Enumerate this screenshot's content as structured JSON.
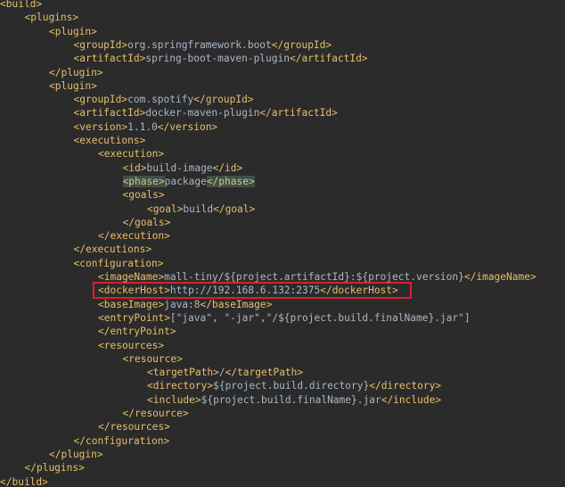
{
  "lines": [
    {
      "indent": 0,
      "open": "<build>"
    },
    {
      "indent": 1,
      "open": "<plugins>"
    },
    {
      "indent": 2,
      "open": "<plugin>"
    },
    {
      "indent": 3,
      "open": "<groupId>",
      "text": "org.springframework.boot",
      "close": "</groupId>"
    },
    {
      "indent": 3,
      "open": "<artifactId>",
      "text": "spring-boot-maven-plugin",
      "close": "</artifactId>"
    },
    {
      "indent": 2,
      "open": "</plugin>"
    },
    {
      "indent": 2,
      "open": "<plugin>"
    },
    {
      "indent": 3,
      "open": "<groupId>",
      "text": "com.spotify",
      "close": "</groupId>"
    },
    {
      "indent": 3,
      "open": "<artifactId>",
      "text": "docker-maven-plugin",
      "close": "</artifactId>"
    },
    {
      "indent": 3,
      "open": "<version>",
      "text": "1.1.0",
      "close": "</version>"
    },
    {
      "indent": 3,
      "open": "<executions>"
    },
    {
      "indent": 4,
      "open": "<execution>"
    },
    {
      "indent": 5,
      "open": "<id>",
      "text": "build-image",
      "close": "</id>"
    },
    {
      "indent": 5,
      "open": "<phase>",
      "text": "package",
      "close": "</phase>",
      "highlight": true
    },
    {
      "indent": 5,
      "open": "<goals>"
    },
    {
      "indent": 6,
      "open": "<goal>",
      "text": "build",
      "close": "</goal>"
    },
    {
      "indent": 5,
      "open": "</goals>"
    },
    {
      "indent": 4,
      "open": "</execution>"
    },
    {
      "indent": 3,
      "open": "</executions>"
    },
    {
      "indent": 3,
      "open": "<configuration>"
    },
    {
      "indent": 4,
      "open": "<imageName>",
      "text": "mall-tiny/${project.artifactId}:${project.version}",
      "close": "</imageName>"
    },
    {
      "indent": 4,
      "open": "<dockerHost>",
      "text": "http://192.168.6.132:2375",
      "close": "</dockerHost>",
      "boxed": true
    },
    {
      "indent": 4,
      "open": "<baseImage>",
      "text": "java:8",
      "close": "</baseImage>"
    },
    {
      "indent": 4,
      "open": "<entryPoint>",
      "text": "[\"java\", \"-jar\",\"/${project.build.finalName}.jar\"]"
    },
    {
      "indent": 4,
      "open": "</entryPoint>"
    },
    {
      "indent": 4,
      "open": "<resources>"
    },
    {
      "indent": 5,
      "open": "<resource>"
    },
    {
      "indent": 6,
      "open": "<targetPath>",
      "text": "/",
      "close": "</targetPath>"
    },
    {
      "indent": 6,
      "open": "<directory>",
      "text": "${project.build.directory}",
      "close": "</directory>"
    },
    {
      "indent": 6,
      "open": "<include>",
      "text": "${project.build.finalName}.jar",
      "close": "</include>"
    },
    {
      "indent": 5,
      "open": "</resource>"
    },
    {
      "indent": 4,
      "open": "</resources>"
    },
    {
      "indent": 3,
      "open": "</configuration>"
    },
    {
      "indent": 2,
      "open": "</plugin>"
    },
    {
      "indent": 1,
      "open": "</plugins>"
    },
    {
      "indent": 0,
      "open": "</build>"
    }
  ],
  "colors": {
    "background": "#2b2b2b",
    "tag": "#e8bf6a",
    "text": "#a9b7c6",
    "highlight_box": "#d8202c"
  }
}
